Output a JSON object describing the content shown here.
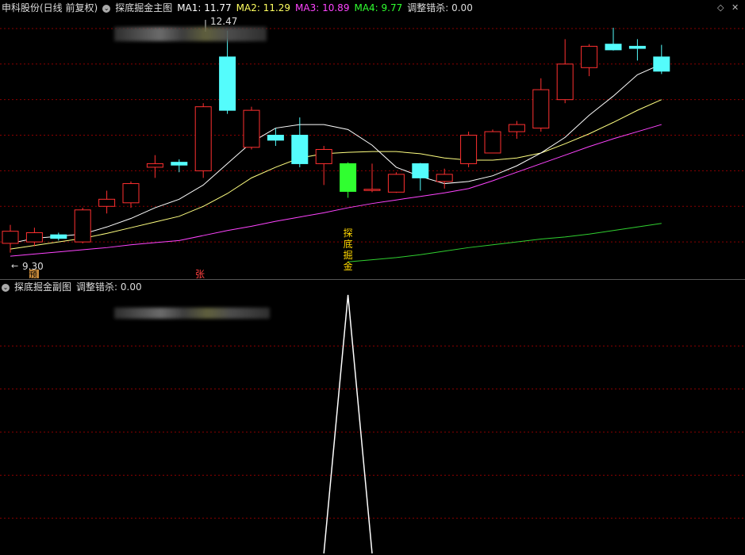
{
  "main_header": {
    "stock": "申科股份(日线 前复权)",
    "indicator": "探底掘金主图",
    "ma1": "MA1: 11.77",
    "ma2": "MA2: 11.29",
    "ma3": "MA3: 10.89",
    "ma4": "MA4: 9.77",
    "adjust": "调整错杀: 0.00"
  },
  "sub_header": {
    "indicator": "探底掘金副图",
    "adjust": "调整错杀: 0.00"
  },
  "annotations": {
    "high_label": "12.47",
    "low_label": "9.30",
    "signal_text": [
      "探",
      "底",
      "掘",
      "金"
    ],
    "badge_yu": "预",
    "badge_zhang": "张"
  },
  "colors": {
    "up": "#ff3030",
    "down": "#54fcfc",
    "signal": "#30ff30",
    "ma1": "#ffffff",
    "ma2": "#ffff80",
    "ma3": "#ff44ff",
    "ma4": "#30d030",
    "grid": "#8b0000"
  },
  "chart_data": {
    "type": "candlestick",
    "ylim": [
      9.0,
      12.7
    ],
    "candles": [
      {
        "o": 9.48,
        "c": 9.65,
        "h": 9.74,
        "l": 9.35
      },
      {
        "o": 9.5,
        "c": 9.63,
        "h": 9.7,
        "l": 9.44
      },
      {
        "o": 9.6,
        "c": 9.55,
        "h": 9.63,
        "l": 9.52
      },
      {
        "o": 9.5,
        "c": 9.95,
        "h": 9.98,
        "l": 9.48
      },
      {
        "o": 10.0,
        "c": 10.1,
        "h": 10.22,
        "l": 9.9
      },
      {
        "o": 10.05,
        "c": 10.32,
        "h": 10.35,
        "l": 9.98
      },
      {
        "o": 10.55,
        "c": 10.6,
        "h": 10.72,
        "l": 10.4
      },
      {
        "o": 10.62,
        "c": 10.58,
        "h": 10.66,
        "l": 10.48
      },
      {
        "o": 10.5,
        "c": 11.4,
        "h": 11.45,
        "l": 10.4
      },
      {
        "o": 12.1,
        "c": 11.35,
        "h": 12.47,
        "l": 11.3
      },
      {
        "o": 10.83,
        "c": 11.35,
        "h": 11.4,
        "l": 10.8
      },
      {
        "o": 11.0,
        "c": 10.93,
        "h": 11.1,
        "l": 10.85
      },
      {
        "o": 11.0,
        "c": 10.6,
        "h": 11.25,
        "l": 10.55
      },
      {
        "o": 10.6,
        "c": 10.8,
        "h": 10.85,
        "l": 10.3
      },
      {
        "o": 10.6,
        "c": 10.21,
        "h": 10.62,
        "l": 10.12
      },
      {
        "o": 10.23,
        "c": 10.24,
        "h": 10.6,
        "l": 10.2
      },
      {
        "o": 10.2,
        "c": 10.45,
        "h": 10.48,
        "l": 10.19
      },
      {
        "o": 10.6,
        "c": 10.4,
        "h": 10.61,
        "l": 10.22
      },
      {
        "o": 10.35,
        "c": 10.45,
        "h": 10.53,
        "l": 10.25
      },
      {
        "o": 10.6,
        "c": 11.0,
        "h": 11.05,
        "l": 10.55
      },
      {
        "o": 10.75,
        "c": 11.05,
        "h": 11.08,
        "l": 10.75
      },
      {
        "o": 11.05,
        "c": 11.15,
        "h": 11.2,
        "l": 10.95
      },
      {
        "o": 11.1,
        "c": 11.64,
        "h": 11.8,
        "l": 11.05
      },
      {
        "o": 11.5,
        "c": 12.0,
        "h": 12.35,
        "l": 11.45
      },
      {
        "o": 11.95,
        "c": 12.25,
        "h": 12.28,
        "l": 11.83
      },
      {
        "o": 12.28,
        "c": 12.2,
        "h": 12.51,
        "l": 12.19
      },
      {
        "o": 12.25,
        "c": 12.22,
        "h": 12.35,
        "l": 12.05
      },
      {
        "o": 12.1,
        "c": 11.9,
        "h": 12.27,
        "l": 11.86
      }
    ],
    "signal_index": 14,
    "ma1": [
      9.48,
      9.55,
      9.58,
      9.61,
      9.71,
      9.83,
      9.98,
      10.1,
      10.3,
      10.6,
      10.9,
      11.1,
      11.15,
      11.15,
      11.08,
      10.86,
      10.55,
      10.42,
      10.32,
      10.35,
      10.43,
      10.57,
      10.75,
      10.97,
      11.28,
      11.55,
      11.85,
      12.0
    ],
    "ma2": [
      9.4,
      9.45,
      9.5,
      9.55,
      9.62,
      9.7,
      9.78,
      9.86,
      10.0,
      10.18,
      10.4,
      10.55,
      10.68,
      10.74,
      10.76,
      10.77,
      10.77,
      10.74,
      10.68,
      10.65,
      10.65,
      10.68,
      10.75,
      10.88,
      11.02,
      11.18,
      11.35,
      11.5
    ],
    "ma3": [
      9.3,
      9.33,
      9.36,
      9.39,
      9.42,
      9.46,
      9.49,
      9.52,
      9.59,
      9.66,
      9.72,
      9.79,
      9.85,
      9.91,
      9.98,
      10.04,
      10.09,
      10.14,
      10.19,
      10.25,
      10.36,
      10.48,
      10.6,
      10.72,
      10.84,
      10.95,
      11.05,
      11.15
    ],
    "ma4": [
      null,
      null,
      null,
      null,
      null,
      null,
      null,
      null,
      null,
      null,
      null,
      null,
      null,
      null,
      9.22,
      9.25,
      9.28,
      9.32,
      9.37,
      9.42,
      9.46,
      9.5,
      9.54,
      9.57,
      9.61,
      9.66,
      9.71,
      9.76
    ],
    "sub_ylim": [
      0,
      1
    ],
    "sub_values": [
      0,
      0,
      0,
      0,
      0,
      0,
      0,
      0,
      0,
      0,
      0,
      0,
      0,
      0,
      1,
      0,
      0,
      0,
      0,
      0,
      0,
      0,
      0,
      0,
      0,
      0,
      0,
      0
    ]
  }
}
